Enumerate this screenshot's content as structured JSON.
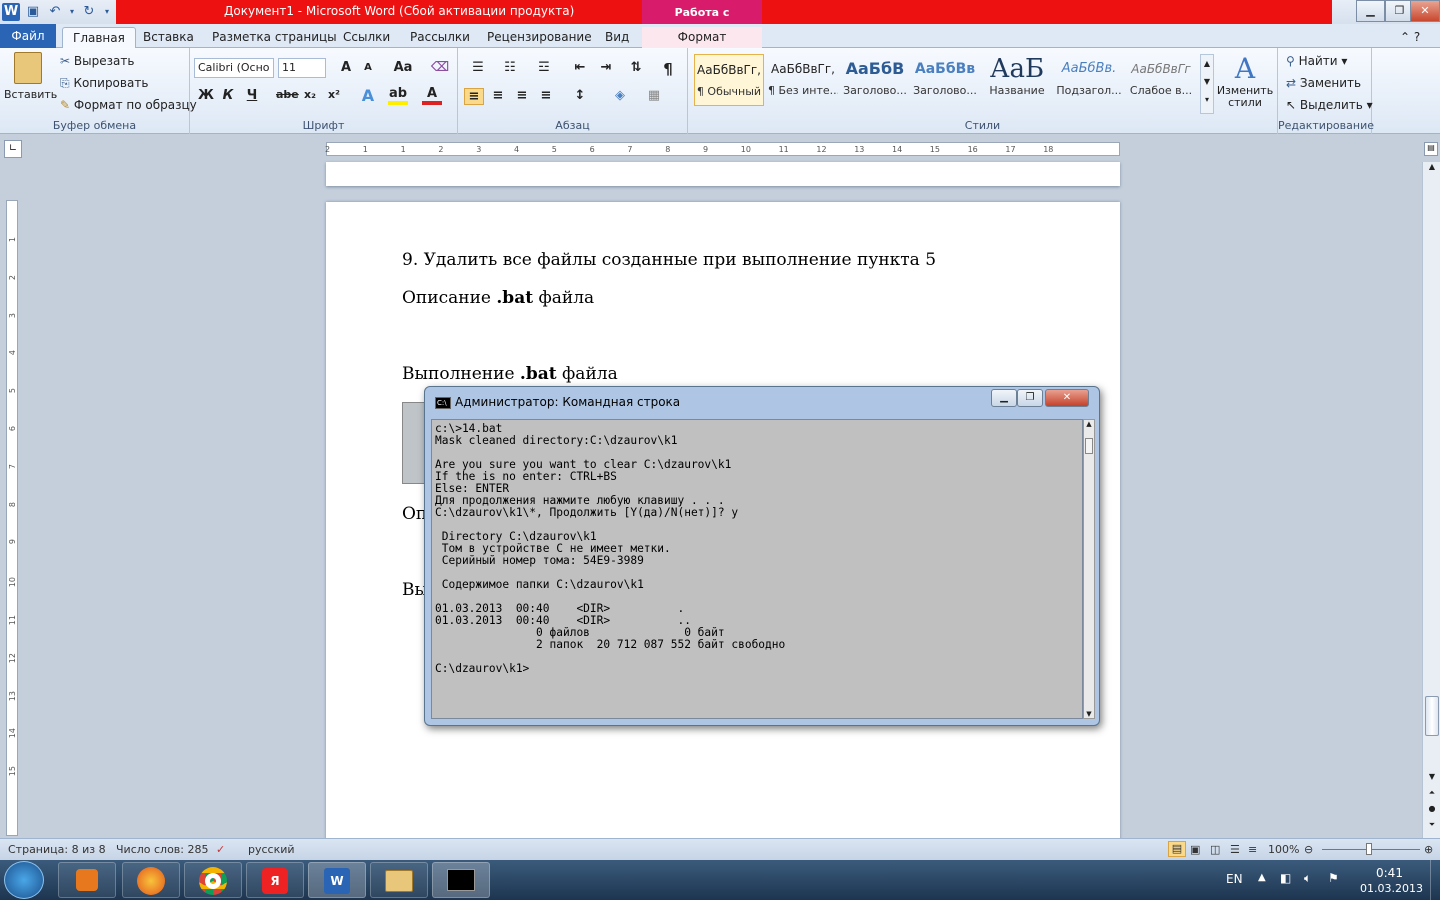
{
  "window": {
    "title": "Документ1  -  Microsoft Word (Сбой активации продукта)",
    "context_tab_title": "Работа с рисунками"
  },
  "ribbon_tabs": [
    "Файл",
    "Главная",
    "Вставка",
    "Разметка страницы",
    "Ссылки",
    "Рассылки",
    "Рецензирование",
    "Вид",
    "Формат"
  ],
  "clipboard": {
    "paste": "Вставить",
    "cut": "Вырезать",
    "copy": "Копировать",
    "format_painter": "Формат по образцу",
    "label": "Буфер обмена"
  },
  "font": {
    "name": "Calibri (Осно",
    "size": "11",
    "label": "Шрифт",
    "bold": "Ж",
    "italic": "К",
    "underline": "Ч",
    "strike": "abe",
    "subscript": "x₂",
    "superscript": "x²",
    "grow": "A",
    "shrink": "A",
    "case": "Aa"
  },
  "paragraph": {
    "label": "Абзац",
    "pilcrow": "¶"
  },
  "styles": {
    "label": "Стили",
    "items": [
      {
        "preview": "АаБбВвГг,",
        "name": "¶ Обычный"
      },
      {
        "preview": "АаБбВвГг,",
        "name": "¶ Без инте..."
      },
      {
        "preview": "АаБбВ",
        "name": "Заголово..."
      },
      {
        "preview": "АаБбВв",
        "name": "Заголово..."
      },
      {
        "preview": "АаБ",
        "name": "Название"
      },
      {
        "preview": "АаБбВв.",
        "name": "Подзагол..."
      },
      {
        "preview": "АаБбВвГг",
        "name": "Слабое в..."
      }
    ],
    "change_styles": "Изменить стили"
  },
  "editing": {
    "find": "Найти",
    "replace": "Заменить",
    "select": "Выделить",
    "label": "Редактирование"
  },
  "ruler": {
    "h_ticks": [
      "2",
      "1",
      "1",
      "2",
      "3",
      "4",
      "5",
      "6",
      "7",
      "8",
      "9",
      "10",
      "11",
      "12",
      "13",
      "14",
      "15",
      "16",
      "17",
      "18"
    ],
    "v_ticks": [
      "1",
      "2",
      "3",
      "4",
      "5",
      "6",
      "7",
      "8",
      "9",
      "10",
      "11",
      "12",
      "13",
      "14",
      "15"
    ]
  },
  "document": {
    "line1": "9. Удалить все файлы созданные при выполнение пункта 5",
    "line2_pre": "Описание ",
    "line2_bold": ".bat",
    "line2_post": " файла",
    "line3_pre": "Выполнение ",
    "line3_bold": ".bat",
    "line3_post": " файла",
    "partial1": "Оп",
    "partial2": "Вы"
  },
  "cmd": {
    "title": "Администратор: Командная строка",
    "icon_text": "C:\\",
    "output": "c:\\>14.bat\nMask cleaned directory:C:\\dzaurov\\k1\n\nAre you sure you want to clear C:\\dzaurov\\k1\nIf the is no enter: CTRL+BS\nElse: ENTER\nДля продолжения нажмите любую клавишу . . .\nC:\\dzaurov\\k1\\*, Продолжить [Y(да)/N(нет)]? y\n\n Directory C:\\dzaurov\\k1\n Том в устройстве C не имеет метки.\n Серийный номер тома: 54E9-3989\n\n Содержимое папки C:\\dzaurov\\k1\n\n01.03.2013  00:40    <DIR>          .\n01.03.2013  00:40    <DIR>          ..\n               0 файлов              0 байт\n               2 папок  20 712 087 552 байт свободно\n\nC:\\dzaurov\\k1>"
  },
  "statusbar": {
    "page": "Страница: 8 из 8",
    "words": "Число слов: 285",
    "language": "русский",
    "zoom": "100%"
  },
  "taskbar": {
    "lang": "EN",
    "time": "0:41",
    "date": "01.03.2013"
  },
  "colors": {
    "title_red": "#ee1111",
    "context_pink": "#d81b6a",
    "file_tab": "#2a64b5"
  }
}
